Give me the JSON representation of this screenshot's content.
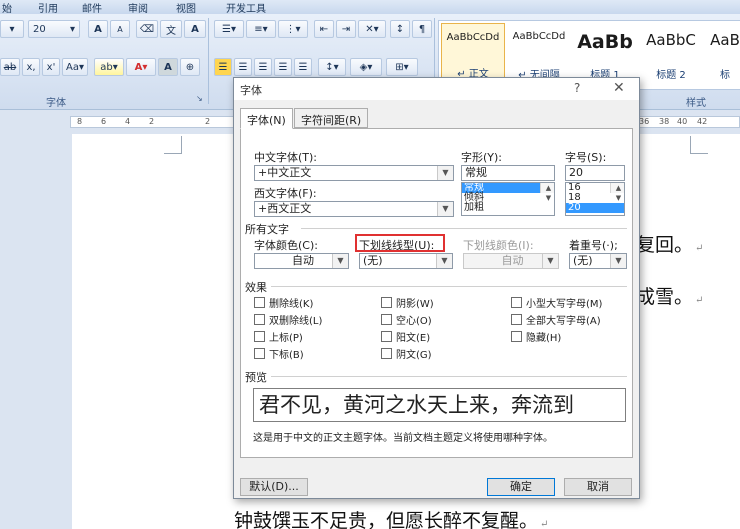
{
  "ribbon": {
    "tabs": [
      "始",
      "引用",
      "邮件",
      "审阅",
      "视图",
      "开发工具"
    ],
    "font_size": "20",
    "font_group_label": "字体",
    "styles_group_label": "样式",
    "styles": [
      {
        "sample": "AaBbCcDd",
        "name": "↵ 正文",
        "selected": true
      },
      {
        "sample": "AaBbCcDd",
        "name": "↵ 无间隔"
      },
      {
        "sample": "AaBb",
        "name": "标题 1"
      },
      {
        "sample": "AaBbC",
        "name": "标题 2"
      },
      {
        "sample": "AaB",
        "name": "标"
      }
    ]
  },
  "ruler_ticks": [
    "8",
    "6",
    "4",
    "2",
    "2",
    "36",
    "38",
    "40",
    "42"
  ],
  "document": {
    "fragment1": "复回。",
    "fragment2": "成雪。",
    "bottom_line": "钟鼓馔玉不足贵，但愿长醉不复醒。"
  },
  "dialog": {
    "title": "字体",
    "help": "?",
    "close": "✕",
    "tabs": [
      "字体(N)",
      "字符间距(R)"
    ],
    "chinese_font_label": "中文字体(T):",
    "chinese_font_value": "+中文正文",
    "western_font_label": "西文字体(F):",
    "western_font_value": "+西文正文",
    "style_label": "字形(Y):",
    "style_value": "常规",
    "style_options": [
      "常规",
      "倾斜",
      "加粗"
    ],
    "size_label": "字号(S):",
    "size_value": "20",
    "size_options": [
      "16",
      "18",
      "20"
    ],
    "all_text_label": "所有文字",
    "font_color_label": "字体颜色(C):",
    "font_color_value": "自动",
    "underline_label": "下划线线型(U):",
    "underline_value": "(无)",
    "underline_color_label": "下划线颜色(I):",
    "underline_color_value": "自动",
    "emphasis_label": "着重号(·);",
    "emphasis_value": "(无)",
    "effects_label": "效果",
    "effects": {
      "strike": "删除线(K)",
      "double_strike": "双删除线(L)",
      "superscript": "上标(P)",
      "subscript": "下标(B)",
      "shadow": "阴影(W)",
      "outline": "空心(O)",
      "emboss": "阳文(E)",
      "engrave": "阴文(G)",
      "small_caps": "小型大写字母(M)",
      "all_caps": "全部大写字母(A)",
      "hidden": "隐藏(H)"
    },
    "preview_label": "预览",
    "preview_text": "君不见，黄河之水天上来，奔流到",
    "note": "这是用于中文的正文主题字体。当前文档主题定义将使用哪种字体。",
    "default_button": "默认(D)...",
    "ok_button": "确定",
    "cancel_button": "取消"
  }
}
